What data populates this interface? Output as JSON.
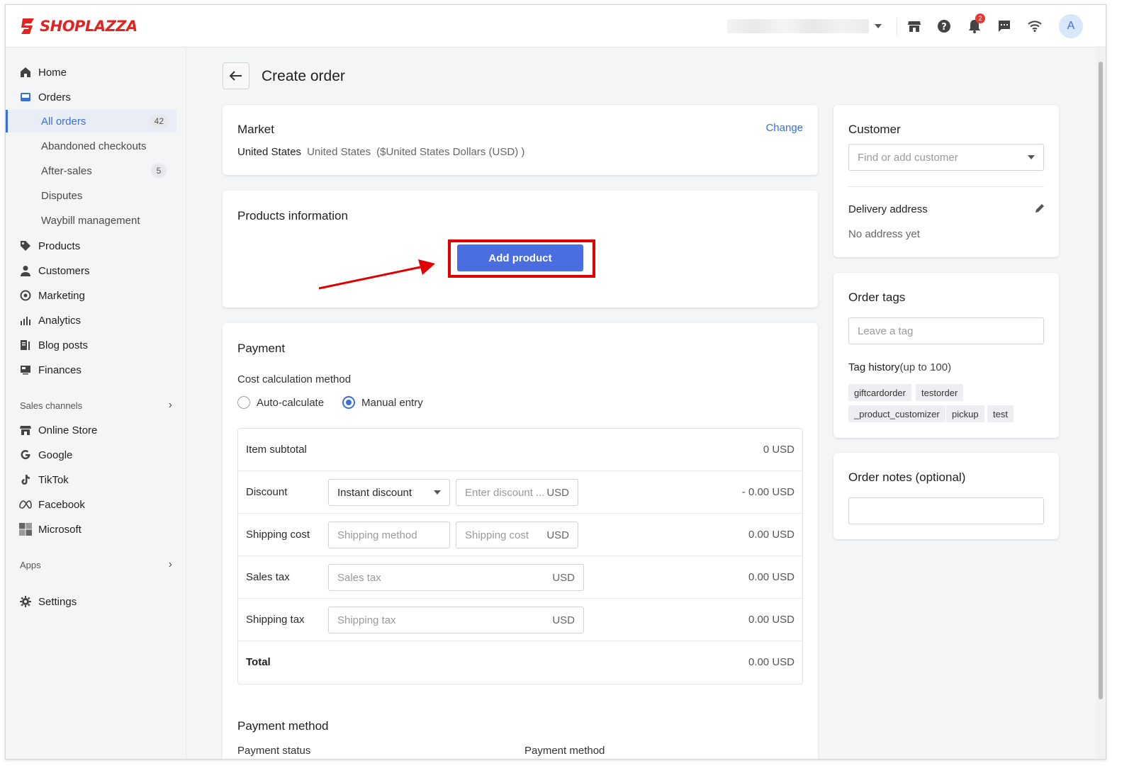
{
  "brand": {
    "logo_text": "SHOPLAZZA",
    "accent": "#e02424"
  },
  "topbar": {
    "notification_count": "2",
    "avatar_initial": "A"
  },
  "sidebar": {
    "home": "Home",
    "orders": "Orders",
    "order_subitems": [
      {
        "label": "All orders",
        "count": "42"
      },
      {
        "label": "Abandoned checkouts",
        "count": ""
      },
      {
        "label": "After-sales",
        "count": "5"
      },
      {
        "label": "Disputes",
        "count": ""
      },
      {
        "label": "Waybill management",
        "count": ""
      }
    ],
    "products": "Products",
    "customers": "Customers",
    "marketing": "Marketing",
    "analytics": "Analytics",
    "blog_posts": "Blog posts",
    "finances": "Finances",
    "sales_channels": "Sales channels",
    "channels": [
      "Online Store",
      "Google",
      "TikTok",
      "Facebook",
      "Microsoft"
    ],
    "apps": "Apps",
    "settings": "Settings"
  },
  "page": {
    "title": "Create order"
  },
  "market": {
    "title": "Market",
    "change": "Change",
    "country": "United States",
    "region": "United States",
    "currency": "($United States Dollars (USD) )"
  },
  "products": {
    "title": "Products information",
    "add_button": "Add product"
  },
  "payment": {
    "title": "Payment",
    "cost_method_label": "Cost calculation method",
    "option_auto": "Auto-calculate",
    "option_manual": "Manual entry",
    "rows": {
      "subtotal_label": "Item subtotal",
      "subtotal_value": "0 USD",
      "discount_label": "Discount",
      "discount_type": "Instant discount",
      "discount_placeholder": "Enter discount ...",
      "discount_value": "- 0.00 USD",
      "shipping_label": "Shipping cost",
      "shipping_method_placeholder": "Shipping method",
      "shipping_cost_placeholder": "Shipping cost",
      "shipping_value": "0.00 USD",
      "sales_tax_label": "Sales tax",
      "sales_tax_placeholder": "Sales tax",
      "sales_tax_value": "0.00 USD",
      "shipping_tax_label": "Shipping tax",
      "shipping_tax_placeholder": "Shipping tax",
      "shipping_tax_value": "0.00 USD",
      "total_label": "Total",
      "total_value": "0.00 USD",
      "unit": "USD"
    },
    "method_title": "Payment method",
    "payment_status_label": "Payment status",
    "payment_method_label": "Payment method"
  },
  "customer": {
    "title": "Customer",
    "search_placeholder": "Find or add customer",
    "delivery_title": "Delivery address",
    "no_address": "No address yet"
  },
  "order_tags": {
    "title": "Order tags",
    "placeholder": "Leave a tag",
    "history_label": "Tag history",
    "history_limit": "(up to 100)",
    "tags": [
      "giftcardorder",
      "testorder",
      "_product_customizer",
      "pickup",
      "test"
    ]
  },
  "order_notes": {
    "title": "Order notes (optional)"
  }
}
